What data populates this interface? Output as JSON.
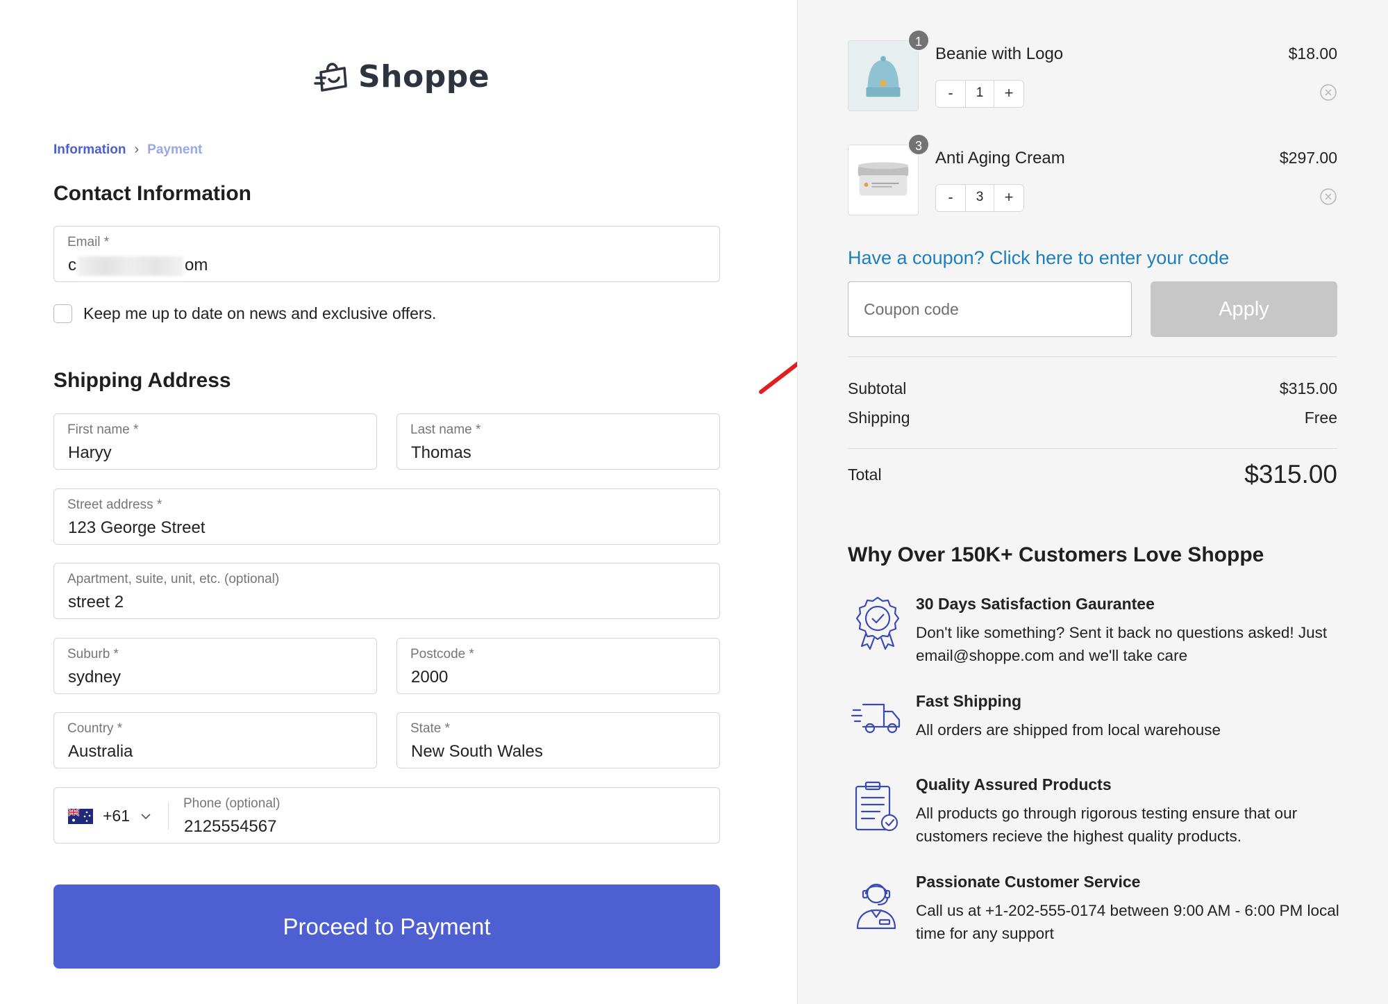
{
  "brand": {
    "name": "Shoppe"
  },
  "breadcrumb": {
    "current": "Information",
    "separator": "›",
    "next": "Payment"
  },
  "contact": {
    "title": "Contact Information",
    "email_label": "Email *",
    "email_prefix": "c",
    "email_suffix": "om",
    "newsletter_label": "Keep me up to date on news and exclusive offers."
  },
  "shipping": {
    "title": "Shipping Address",
    "first_name": {
      "label": "First name *",
      "value": "Haryy"
    },
    "last_name": {
      "label": "Last name *",
      "value": "Thomas"
    },
    "street": {
      "label": "Street address *",
      "value": "123 George Street"
    },
    "apartment": {
      "label": "Apartment, suite, unit, etc. (optional)",
      "value": "street 2"
    },
    "suburb": {
      "label": "Suburb *",
      "value": "sydney"
    },
    "postcode": {
      "label": "Postcode *",
      "value": "2000"
    },
    "country": {
      "label": "Country *",
      "value": "Australia"
    },
    "state": {
      "label": "State *",
      "value": "New South Wales"
    },
    "phone": {
      "code": "+61",
      "label": "Phone (optional)",
      "value": "2125554567"
    }
  },
  "proceed_label": "Proceed to Payment",
  "cart": {
    "items": [
      {
        "name": "Beanie with Logo",
        "price": "$18.00",
        "qty": "1",
        "badge": "1",
        "minus": "-",
        "plus": "+"
      },
      {
        "name": "Anti Aging Cream",
        "price": "$297.00",
        "qty": "3",
        "badge": "3",
        "minus": "-",
        "plus": "+"
      }
    ]
  },
  "coupon": {
    "link": "Have a coupon? Click here to enter your code",
    "placeholder": "Coupon code",
    "apply": "Apply"
  },
  "summary": {
    "subtotal_label": "Subtotal",
    "subtotal": "$315.00",
    "shipping_label": "Shipping",
    "shipping": "Free",
    "total_label": "Total",
    "total": "$315.00"
  },
  "why": {
    "title": "Why Over 150K+ Customers Love Shoppe",
    "features": [
      {
        "icon": "award-badge-icon",
        "title": "30 Days Satisfaction Gaurantee",
        "desc": "Don't like something? Sent it back no questions asked! Just email@shoppe.com and we'll take care"
      },
      {
        "icon": "delivery-truck-icon",
        "title": "Fast Shipping",
        "desc": "All orders are shipped from local warehouse"
      },
      {
        "icon": "clipboard-check-icon",
        "title": "Quality Assured Products",
        "desc": "All products go through rigorous testing ensure that our customers recieve the highest quality products."
      },
      {
        "icon": "support-agent-icon",
        "title": "Passionate Customer Service",
        "desc": "Call us at +1-202-555-0174 between 9:00 AM - 6:00 PM local time for any support"
      }
    ]
  },
  "colors": {
    "primary": "#4d5fd1",
    "link": "#1c7fc0",
    "annotation_arrow": "#e02020",
    "icon_blue": "#3a4bb8"
  }
}
